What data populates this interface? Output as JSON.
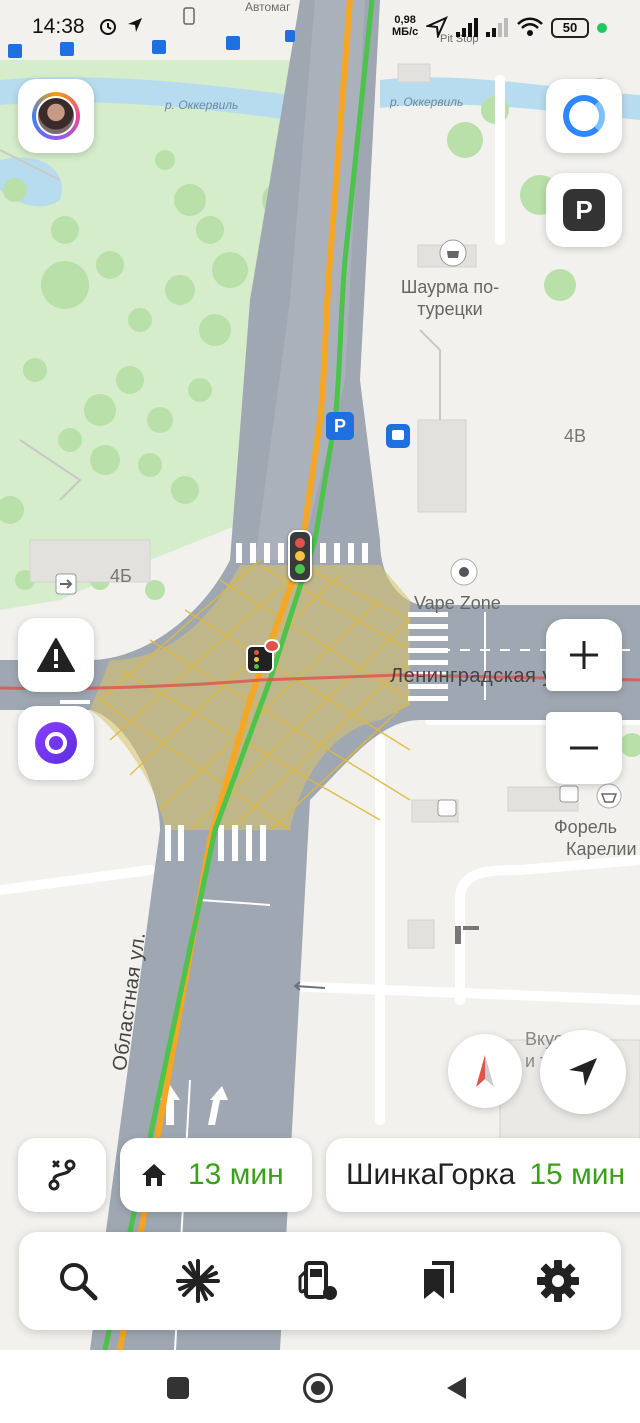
{
  "status_bar": {
    "time": "14:38",
    "speed_value": "0,98",
    "speed_unit": "МБ/с",
    "battery": "50"
  },
  "map": {
    "labels": {
      "top_shop": "Автомаг",
      "pit_stop": "Pit Stop",
      "river_left": "р. Оккервиль",
      "river_right": "р. Оккервиль",
      "shawarma_line1": "Шаурма по-",
      "shawarma_line2": "турецки",
      "house_4v": "4В",
      "house_4b": "4Б",
      "vape_zone": "Vape Zone",
      "leningradskaya": "Ленинградская ул.",
      "oblastnaya": "Областная ул.",
      "forel_line1": "Форель",
      "forel_line2": "Карелии",
      "vkusno_line1": "Вкусно —",
      "vkusno_line2": "и точка"
    },
    "icons": [
      "parking-icon",
      "bus-stop-icon",
      "traffic-light-icon",
      "traffic-camera-icon",
      "cafe-icon",
      "entrance-icon",
      "shop-basket-icon"
    ]
  },
  "controls": {
    "left": [
      "profile-avatar",
      "road-event-icon",
      "alice-icon"
    ],
    "right": [
      "alice-assistant-icon",
      "parking-layer-icon",
      "zoom-in-icon",
      "zoom-out-icon",
      "compass-icon",
      "my-location-icon"
    ]
  },
  "routes": {
    "chips": [
      {
        "icon": "route-icon"
      },
      {
        "icon": "home-icon",
        "name": "",
        "time": "13 мин"
      },
      {
        "name": "ШинкаГорка",
        "time": "15 мин"
      }
    ]
  },
  "toolbar": {
    "items": [
      "search-icon",
      "discovery-icon",
      "gas-station-icon",
      "bookmarks-icon",
      "settings-icon"
    ]
  },
  "colors": {
    "accent_green": "#3aa019",
    "route_orange": "#f5a623",
    "traffic_green": "#4cc34a",
    "park_green": "#d7efcf",
    "water": "#b7dbee",
    "road": "#9ea6b1"
  }
}
